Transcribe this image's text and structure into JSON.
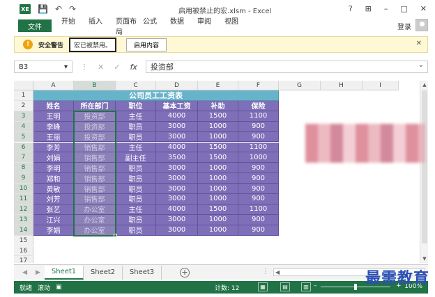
{
  "window": {
    "title": "启用被禁止的宏.xlsm - Excel",
    "logo": "XE",
    "controls": [
      "?",
      "⊞",
      "–",
      "□",
      "✕"
    ]
  },
  "qat": {
    "save": "💾",
    "undo": "↶",
    "redo": "↷"
  },
  "ribbon": {
    "file": "文件",
    "tabs": [
      "开始",
      "插入",
      "页面布局",
      "公式",
      "数据",
      "审阅",
      "视图"
    ],
    "login": "登录"
  },
  "security": {
    "title": "安全警告",
    "message": "宏已被禁用。",
    "button": "启用内容",
    "close": "✕"
  },
  "formula_bar": {
    "name_box": "B3",
    "value": "投资部",
    "fx": "fx",
    "cancel": "✕",
    "enter": "✓"
  },
  "columns": [
    "A",
    "B",
    "C",
    "D",
    "E",
    "F",
    "G",
    "H",
    "I"
  ],
  "rows": [
    "1",
    "2",
    "3",
    "4",
    "5",
    "6",
    "7",
    "8",
    "9",
    "10",
    "11",
    "12",
    "13",
    "14",
    "15",
    "16",
    "17"
  ],
  "table": {
    "title": "公司员工工资表",
    "headers": [
      "姓名",
      "所在部门",
      "职位",
      "基本工资",
      "补助",
      "保险"
    ],
    "data": [
      [
        "王明",
        "投资部",
        "主任",
        "4000",
        "1500",
        "1100"
      ],
      [
        "李峰",
        "投资部",
        "职员",
        "3000",
        "1000",
        "900"
      ],
      [
        "王丽",
        "投资部",
        "职员",
        "3000",
        "1000",
        "900"
      ],
      [
        "李芳",
        "销售部",
        "主任",
        "4000",
        "1500",
        "1100"
      ],
      [
        "刘娟",
        "销售部",
        "副主任",
        "3500",
        "1500",
        "1000"
      ],
      [
        "李明",
        "销售部",
        "职员",
        "3000",
        "1000",
        "900"
      ],
      [
        "郑和",
        "销售部",
        "职员",
        "3000",
        "1000",
        "900"
      ],
      [
        "黄敏",
        "销售部",
        "职员",
        "3000",
        "1000",
        "900"
      ],
      [
        "刘芳",
        "销售部",
        "职员",
        "3000",
        "1000",
        "900"
      ],
      [
        "张艺",
        "办公室",
        "主任",
        "4000",
        "1500",
        "1100"
      ],
      [
        "江兴",
        "办公室",
        "职员",
        "3000",
        "1000",
        "900"
      ],
      [
        "李娟",
        "办公室",
        "职员",
        "3000",
        "1000",
        "900"
      ]
    ]
  },
  "sheets": [
    "Sheet1",
    "Sheet2",
    "Sheet3"
  ],
  "status": {
    "ready": "就绪",
    "scroll": "滚动",
    "count": "计数: 12",
    "zoom": "100%"
  },
  "watermark": "最需教育",
  "colors": {
    "excel_green": "#217346",
    "table_purple": "#7f6fb8",
    "title_teal": "#67b3c9",
    "warning": "#fff8d5"
  }
}
